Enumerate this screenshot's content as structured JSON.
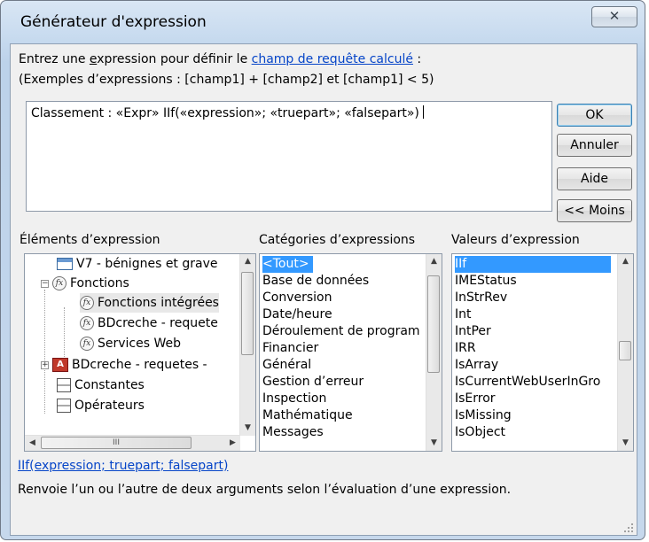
{
  "window": {
    "title": "Générateur d'expression",
    "close_symbol": "✕"
  },
  "prompt": {
    "line1_prefix_before_access": "Entrez une ",
    "line1_access_letter": "e",
    "line1_mid": "xpression pour définir le ",
    "line1_link": "champ de requête calculé",
    "line1_suffix": " :",
    "line2": "(Exemples d’expressions : [champ1] + [champ2] et [champ1] < 5)"
  },
  "expression": {
    "value": "Classement : «Expr» IIf(«expression»; «truepart»; «falsepart»)"
  },
  "buttons": {
    "ok": "OK",
    "cancel": "Annuler",
    "help": "Aide",
    "less": "<< Moins"
  },
  "elements_panel": {
    "label": "Éléments d’expression",
    "tree": [
      {
        "label": "V7 - bénignes et grave",
        "icon": "table-icon"
      },
      {
        "label": "Fonctions",
        "icon": "function-icon",
        "expander": "−"
      },
      {
        "label": "Fonctions intégrées",
        "icon": "function-icon"
      },
      {
        "label": "BDcreche - requete",
        "icon": "function-icon"
      },
      {
        "label": "Services Web",
        "icon": "function-icon"
      },
      {
        "label": "BDcreche - requetes - ",
        "icon": "database-icon",
        "expander": "+"
      },
      {
        "label": "Constantes",
        "icon": "constants-icon"
      },
      {
        "label": "Opérateurs",
        "icon": "operators-icon"
      }
    ],
    "hscroll_grip": "III"
  },
  "categories_panel": {
    "label": "Catégories d’expressions",
    "items": [
      "<Tout>",
      "Base de données",
      "Conversion",
      "Date/heure",
      "Déroulement de program",
      "Financier",
      "Général",
      "Gestion d’erreur",
      "Inspection",
      "Mathématique",
      "Messages"
    ],
    "selected_index": 0
  },
  "values_panel": {
    "label": "Valeurs d’expression",
    "items": [
      "IIf",
      "IMEStatus",
      "InStrRev",
      "Int",
      "IntPer",
      "IRR",
      "IsArray",
      "IsCurrentWebUserInGro",
      "IsError",
      "IsMissing",
      "IsObject"
    ],
    "selected_index": 0
  },
  "signature": {
    "text": "IIf(expression; truepart; falsepart)"
  },
  "description": {
    "text": "Renvoie l’un ou l’autre de deux arguments selon l’évaluation d’une expression."
  },
  "colors": {
    "selection": "#3399ff",
    "link": "#0645c8",
    "client_bg": "#f0f0f0"
  }
}
